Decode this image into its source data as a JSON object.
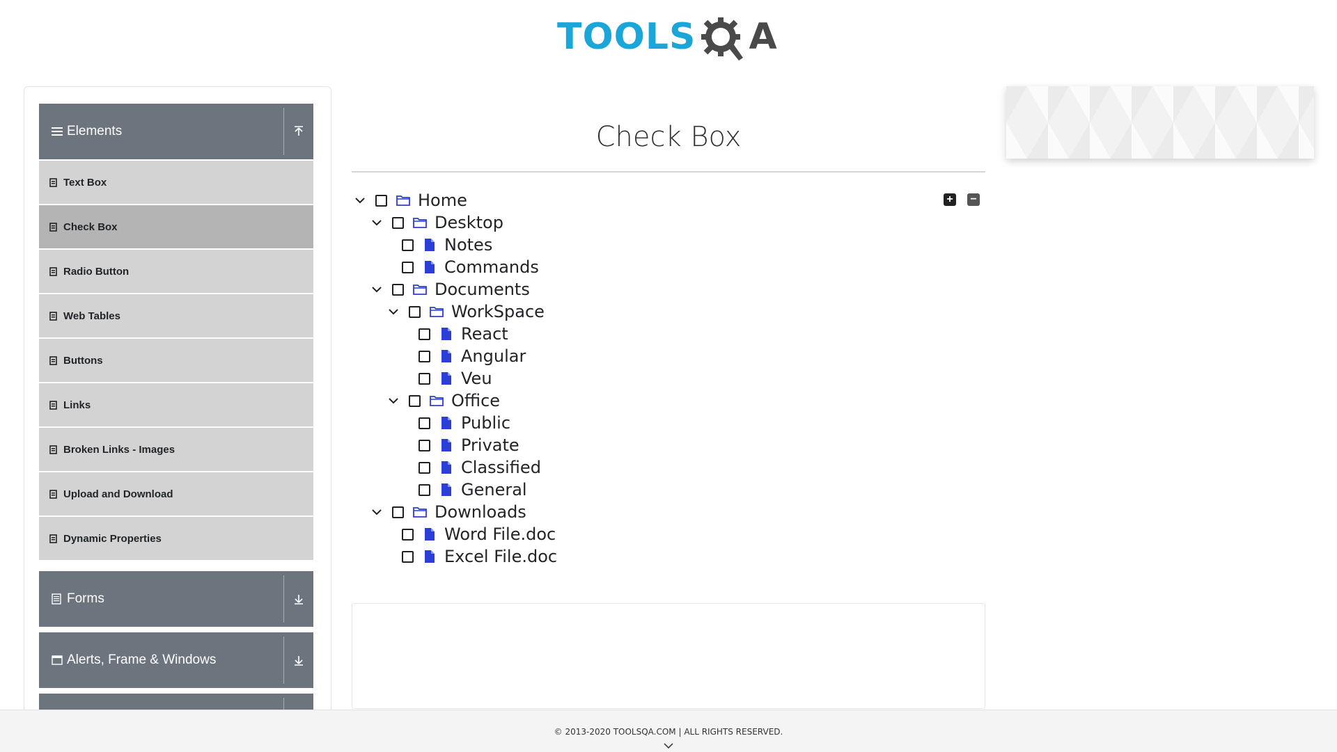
{
  "logo": {
    "tools": "TOOLS",
    "q": "Q",
    "a": "A"
  },
  "sidebar": {
    "groups": [
      {
        "label": "Elements"
      },
      {
        "label": "Forms"
      },
      {
        "label": "Alerts, Frame & Windows"
      }
    ],
    "items": [
      {
        "label": "Text Box"
      },
      {
        "label": "Check Box"
      },
      {
        "label": "Radio Button"
      },
      {
        "label": "Web Tables"
      },
      {
        "label": "Buttons"
      },
      {
        "label": "Links"
      },
      {
        "label": "Broken Links - Images"
      },
      {
        "label": "Upload and Download"
      },
      {
        "label": "Dynamic Properties"
      }
    ]
  },
  "main": {
    "title": "Check Box",
    "tree": [
      {
        "label": "Home"
      },
      {
        "label": "Desktop"
      },
      {
        "label": "Notes"
      },
      {
        "label": "Commands"
      },
      {
        "label": "Documents"
      },
      {
        "label": "WorkSpace"
      },
      {
        "label": "React"
      },
      {
        "label": "Angular"
      },
      {
        "label": "Veu"
      },
      {
        "label": "Office"
      },
      {
        "label": "Public"
      },
      {
        "label": "Private"
      },
      {
        "label": "Classified"
      },
      {
        "label": "General"
      },
      {
        "label": "Downloads"
      },
      {
        "label": "Word File.doc"
      },
      {
        "label": "Excel File.doc"
      }
    ],
    "expand_all_label": "+",
    "collapse_all_label": "−"
  },
  "footer": {
    "text": "© 2013-2020 TOOLSQA.COM | ALL RIGHTS RESERVED."
  },
  "colors": {
    "accent_blue": "#1aa6d9",
    "sidebar_header": "#6c757d",
    "menu_item": "#d3d3d3",
    "menu_item_active": "#b4b4b4",
    "folder_icon": "#2b3fd6",
    "file_icon": "#2b3fd6"
  }
}
